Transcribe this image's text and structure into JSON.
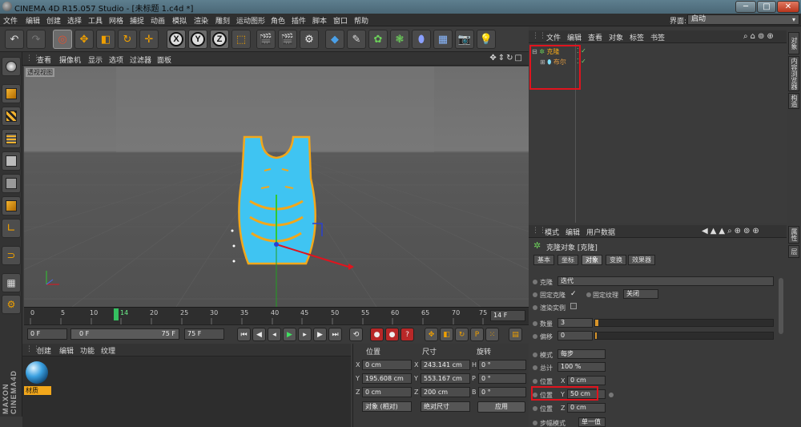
{
  "window": {
    "title": "CINEMA 4D R15.057 Studio - [未标题 1.c4d *]",
    "min": "─",
    "max": "□",
    "close": "✕"
  },
  "menu": [
    "文件",
    "编辑",
    "创建",
    "选择",
    "工具",
    "网格",
    "捕捉",
    "动画",
    "模拟",
    "渲染",
    "雕刻",
    "运动图形",
    "角色",
    "插件",
    "脚本",
    "窗口",
    "帮助"
  ],
  "layout": {
    "label": "界面:",
    "value": "启动"
  },
  "toolbar": {
    "icons": [
      "undo-icon",
      "redo-icon",
      "live-select-icon",
      "move-icon",
      "scale-icon",
      "rotate-icon",
      "last-tool-icon"
    ],
    "axes": [
      "X",
      "Y",
      "Z"
    ]
  },
  "viewport": {
    "menu": [
      "查看",
      "摄像机",
      "显示",
      "选项",
      "过滤器",
      "面板"
    ],
    "label": "透视视图"
  },
  "timeline": {
    "ticks": [
      "0",
      "5",
      "10",
      "14",
      "20",
      "25",
      "30",
      "35",
      "40",
      "45",
      "50",
      "55",
      "60",
      "65",
      "70",
      "75"
    ],
    "current_frame": "14",
    "frame_display": "14 F"
  },
  "playback": {
    "start": "0 F",
    "range_start": "0 F",
    "range_end": "75 F",
    "end": "75 F"
  },
  "material": {
    "menu": [
      "创建",
      "编辑",
      "功能",
      "纹理"
    ],
    "name": "材质"
  },
  "coords": {
    "headers": {
      "position": "位置",
      "size": "尺寸",
      "rotation": "旋转"
    },
    "rows": [
      {
        "axis": "X",
        "pos": "0 cm",
        "size": "243.141 cm",
        "rot_axis": "H",
        "rot": "0 °"
      },
      {
        "axis": "Y",
        "pos": "195.608 cm",
        "size": "553.167 cm",
        "rot_axis": "P",
        "rot": "0 °"
      },
      {
        "axis": "Z",
        "pos": "0 cm",
        "size": "200 cm",
        "rot_axis": "B",
        "rot": "0 °"
      }
    ],
    "mode": "对象 (相对)",
    "size_mode": "绝对尺寸",
    "apply": "应用"
  },
  "objects": {
    "menu": [
      "文件",
      "编辑",
      "查看",
      "对象",
      "标签",
      "书签"
    ],
    "items": [
      {
        "name": "克隆",
        "expander": "⊟"
      },
      {
        "name": "布尔",
        "expander": "⊞"
      }
    ]
  },
  "right_tabs": {
    "objects": "对象",
    "structure": "内容浏览器",
    "layers": "构造",
    "attributes": "属性",
    "layer": "层"
  },
  "attributes": {
    "menu": [
      "模式",
      "编辑",
      "用户数据"
    ],
    "title": "克隆对象 [克隆]",
    "tabs": [
      "基本",
      "坐标",
      "对象",
      "变换",
      "效果器"
    ],
    "active_tab": "对象",
    "clones_label": "克隆",
    "clones_value": "迭代",
    "fixed_clone_label": "固定克隆",
    "fixed_clone_check": "✓",
    "fixed_texture_label": "固定纹理",
    "fixed_texture_value": "关闭",
    "render_instances_label": "渲染实例",
    "count_label": "数量",
    "count_value": "3",
    "count_fill": 0.02,
    "offset_label": "偏移",
    "offset_value": "0",
    "offset_fill": 0,
    "mode_label": "模式",
    "mode_value": "每步",
    "total_label": "总计",
    "total_value": "100 %",
    "pos_x_label": "位置",
    "pos_x_axis": "X",
    "pos_x_value": "0 cm",
    "pos_y_label": "位置",
    "pos_y_axis": "Y",
    "pos_y_value": "50 cm",
    "pos_z_label": "位置",
    "pos_z_axis": "Z",
    "pos_z_value": "0 cm",
    "step_mode_label": "步幅模式",
    "step_mode_value": "单一值"
  }
}
